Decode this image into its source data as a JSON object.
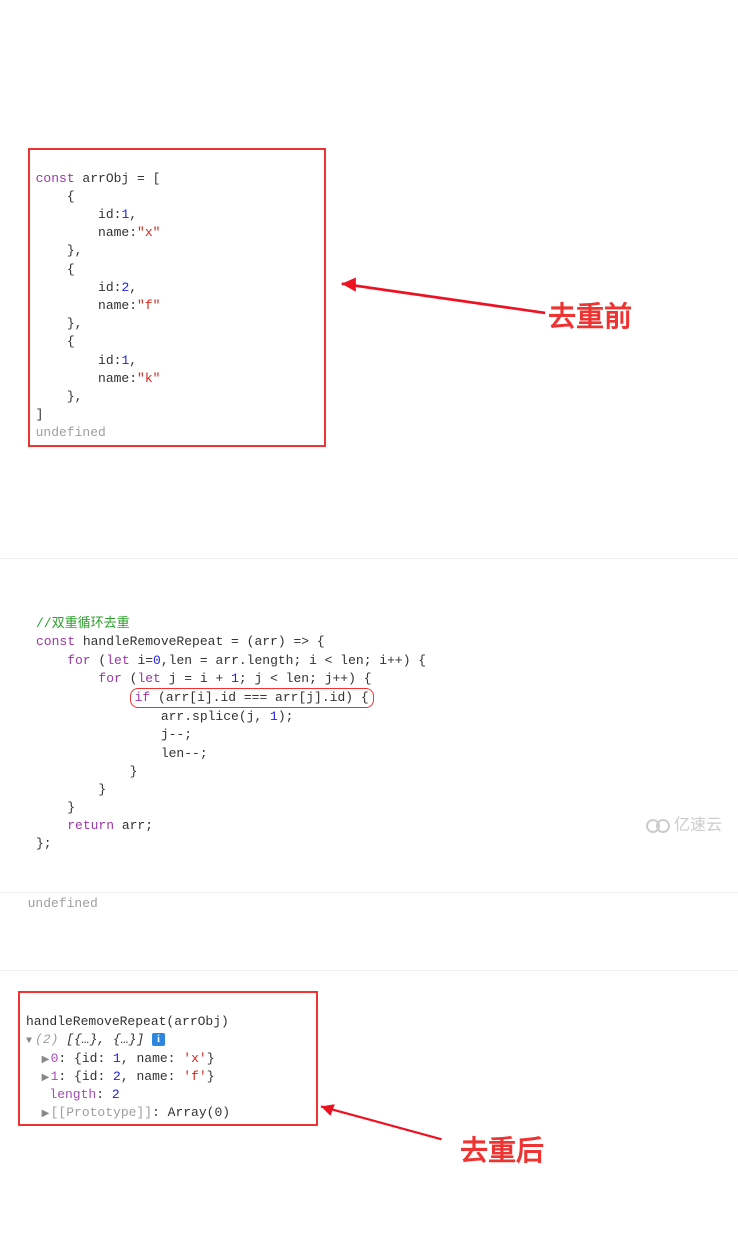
{
  "annotations": {
    "before_label": "去重前",
    "after_label": "去重后"
  },
  "block1": {
    "l1_kw": "const",
    "l1_rest": " arrObj = [",
    "l2": "    {",
    "l3a": "        id:",
    "l3n": "1",
    "l3c": ",",
    "l4a": "        name:",
    "l4s": "\"x\"",
    "l5": "    },",
    "l6": "    {",
    "l7a": "        id:",
    "l7n": "2",
    "l7c": ",",
    "l8a": "        name:",
    "l8s": "\"f\"",
    "l9": "    },",
    "l10": "    {",
    "l11a": "        id:",
    "l11n": "1",
    "l11c": ",",
    "l12a": "        name:",
    "l12s": "\"k\"",
    "l13": "    },",
    "l14": "]",
    "undef": "undefined"
  },
  "block2": {
    "comment": "//双重循环去重",
    "l1_kw": "const",
    "l1_rest": " handleRemoveRepeat = (arr) => {",
    "l2_kw": "for",
    "l2_a": " (",
    "l2_let": "let",
    "l2_b": " i=",
    "l2_n0": "0",
    "l2_c": ",len = arr.length; i < len; i++) {",
    "l3_kw": "for",
    "l3_a": " (",
    "l3_let": "let",
    "l3_b": " j = i + ",
    "l3_n1": "1",
    "l3_c": "; j < len; j++) {",
    "l4_kw": "if",
    "l4_rest": " (arr[i].id === arr[j].id) {",
    "l5a": "                arr.splice(j, ",
    "l5n": "1",
    "l5b": ");",
    "l6": "                j--;",
    "l7": "                len--;",
    "l8": "            }",
    "l9": "        }",
    "l10": "    }",
    "l11_kw": "return",
    "l11_rest": " arr;",
    "l12": "};",
    "undef": "undefined"
  },
  "block3": {
    "call": "handleRemoveRepeat(arrObj)",
    "summary_a": "(2)",
    "summary_b": " [{…}, {…}]",
    "r0_idx": "0",
    "r0_body": " {id: ",
    "r0_id": "1",
    "r0_mid": ", name: ",
    "r0_name": "'x'",
    "r0_end": "}",
    "r1_idx": "1",
    "r1_body": " {id: ",
    "r1_id": "2",
    "r1_mid": ", name: ",
    "r1_name": "'f'",
    "r1_end": "}",
    "len_k": "length",
    "len_v": "2",
    "proto_k": "[[Prototype]]",
    "proto_v": " Array(0)"
  },
  "watermark": "亿速云"
}
